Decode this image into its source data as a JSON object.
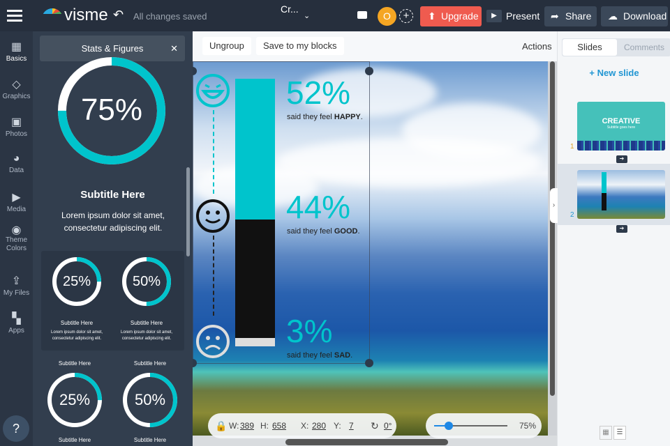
{
  "topbar": {
    "brand": "visme",
    "save_status": "All changes saved",
    "doc_title": "Cr...",
    "avatar_initial": "O",
    "upgrade": "Upgrade",
    "present": "Present",
    "share": "Share",
    "download": "Download"
  },
  "rail": {
    "items": [
      {
        "label": "Basics",
        "icon": "blocks-icon"
      },
      {
        "label": "Graphics",
        "icon": "shapes-icon"
      },
      {
        "label": "Photos",
        "icon": "image-icon"
      },
      {
        "label": "Data",
        "icon": "pie-chart-icon"
      },
      {
        "label": "Media",
        "icon": "media-icon"
      },
      {
        "label": "Theme Colors",
        "icon": "palette-icon"
      },
      {
        "label": "My Files",
        "icon": "upload-icon"
      },
      {
        "label": "Apps",
        "icon": "apps-icon"
      }
    ],
    "help": "?"
  },
  "panel": {
    "title": "Stats & Figures",
    "big": {
      "value": "75%",
      "progress": 0.75,
      "subtitle": "Subtitle Here",
      "text": "Lorem ipsum dolor sit amet, consectetur adipiscing elit."
    },
    "cards": [
      {
        "value": "25%",
        "progress": 0.25,
        "subtitle": "Subtitle Here",
        "text": "Lorem ipsum dolor sit amet, consectetur adipiscing elit."
      },
      {
        "value": "50%",
        "progress": 0.5,
        "subtitle": "Subtitle Here",
        "text": "Lorem ipsum dolor sit amet, consectetur adipiscing elit."
      }
    ],
    "row2": [
      {
        "subtitle_top": "Subtitle Here",
        "value": "25%",
        "progress": 0.25,
        "subtitle": "Subtitle Here"
      },
      {
        "subtitle_top": "Subtitle Here",
        "value": "50%",
        "progress": 0.5,
        "subtitle": "Subtitle Here"
      }
    ]
  },
  "toolbar": {
    "ungroup": "Ungroup",
    "save_blocks": "Save to my blocks",
    "actions": "Actions"
  },
  "slide": {
    "stats": [
      {
        "value": "52%",
        "prefix": "said they feel ",
        "emph": "HAPPY",
        "suffix": "."
      },
      {
        "value": "44%",
        "prefix": "said they feel ",
        "emph": "GOOD",
        "suffix": "."
      },
      {
        "value": "3%",
        "prefix": "said they feel ",
        "emph": "SAD",
        "suffix": "."
      }
    ],
    "bar": {
      "happy": 52,
      "good": 44,
      "sad": 3
    },
    "colors": {
      "accent": "#00c4cc",
      "dark": "#111111",
      "light": "#dddddd"
    }
  },
  "infobar": {
    "w_label": "W:",
    "w": "389",
    "h_label": "H:",
    "h": "658",
    "x_label": "X:",
    "x": "280",
    "y_label": "Y:",
    "y": "7",
    "rotation": "0°",
    "zoom": "75%",
    "zoom_level": 0.75
  },
  "right": {
    "tab_slides": "Slides",
    "tab_comments": "Comments",
    "new_slide": "+ New slide",
    "thumbs": [
      {
        "num": "1",
        "title": "CREATIVE",
        "subtitle": "Subtitle goes here"
      },
      {
        "num": "2"
      }
    ]
  }
}
